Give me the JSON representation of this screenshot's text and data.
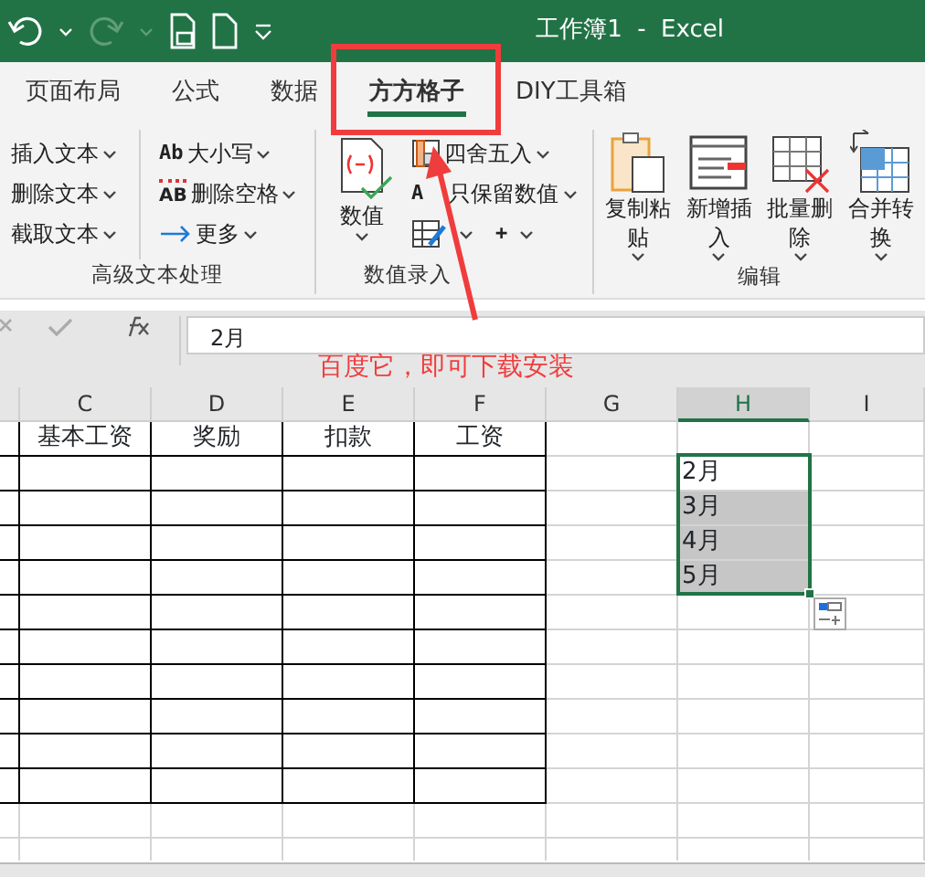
{
  "title_bar": {
    "title": "工作簿1  -  Excel"
  },
  "tabs": [
    {
      "label": "页面布局",
      "selected": false
    },
    {
      "label": "公式",
      "selected": false
    },
    {
      "label": "数据",
      "selected": false
    },
    {
      "label": "方方格子",
      "selected": true
    },
    {
      "label": "DIY工具箱",
      "selected": false
    }
  ],
  "ribbon_groups": [
    {
      "label": "高级文本处理",
      "items": [
        {
          "kind": "small",
          "label": "插入文本"
        },
        {
          "kind": "small",
          "label": "删除文本"
        },
        {
          "kind": "small",
          "label": "截取文本"
        },
        {
          "kind": "small",
          "icon_text": "Ab",
          "label": "大小写"
        },
        {
          "kind": "small",
          "icon_text": "AB",
          "label": "删除空格"
        },
        {
          "kind": "small",
          "label": "更多"
        }
      ]
    },
    {
      "label": "数值录入",
      "items": [
        {
          "kind": "big",
          "label": "数值"
        },
        {
          "kind": "small",
          "label": "四舍五入"
        },
        {
          "kind": "small",
          "icon_text": "A",
          "label": "只保留数值"
        },
        {
          "kind": "small"
        },
        {
          "kind": "small",
          "icon_text": "+"
        }
      ]
    },
    {
      "label": "编辑",
      "items": [
        {
          "kind": "big",
          "label": "复制粘贴"
        },
        {
          "kind": "big",
          "label": "新增插入"
        },
        {
          "kind": "big",
          "label": "批量删除"
        },
        {
          "kind": "big",
          "label": "合并转换"
        }
      ]
    }
  ],
  "formula_bar": {
    "value": "2月"
  },
  "columns": [
    {
      "label": "C",
      "selected": false
    },
    {
      "label": "D",
      "selected": false
    },
    {
      "label": "E",
      "selected": false
    },
    {
      "label": "F",
      "selected": false
    },
    {
      "label": "G",
      "selected": false
    },
    {
      "label": "H",
      "selected": true
    },
    {
      "label": "I",
      "selected": false
    }
  ],
  "table_header": [
    "基本工资",
    "奖励",
    "扣款",
    "工资"
  ],
  "h_cells": [
    {
      "text": "2月",
      "selected": false
    },
    {
      "text": "3月",
      "selected": true
    },
    {
      "text": "4月",
      "selected": true
    },
    {
      "text": "5月",
      "selected": true
    }
  ],
  "annotation": {
    "text": "百度它，即可下载安装"
  }
}
